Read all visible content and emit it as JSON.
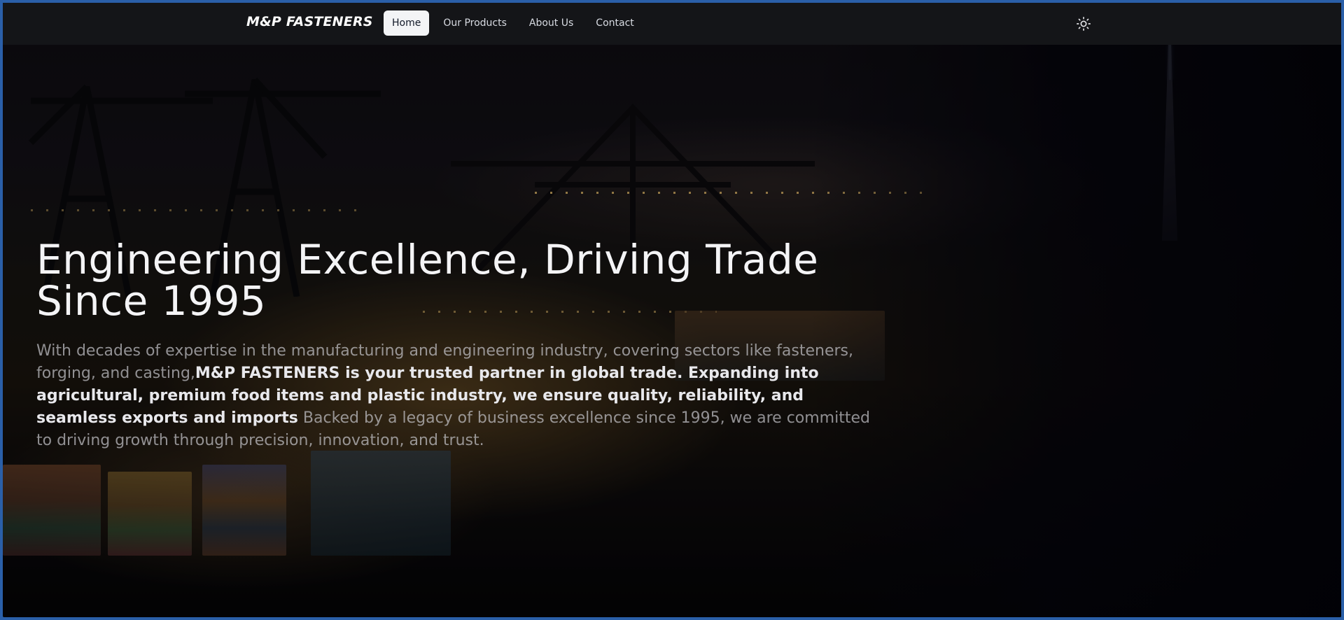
{
  "brand": {
    "name": "M&P FASTENERS"
  },
  "nav": {
    "items": [
      {
        "label": "Home",
        "active": true
      },
      {
        "label": "Our Products",
        "active": false
      },
      {
        "label": "About Us",
        "active": false
      },
      {
        "label": "Contact",
        "active": false
      }
    ],
    "theme_toggle_icon": "sun-icon"
  },
  "hero": {
    "title_line1": "Engineering Excellence, Driving Trade",
    "title_line2": "Since 1995",
    "desc_intro": "With decades of expertise in the manufacturing and engineering industry, covering sectors like fasteners, forging, and casting,",
    "desc_bold": "M&P FASTENERS is your trusted partner in global trade. Expanding into agricultural, premium food items and plastic industry, we ensure quality, reliability, and seamless exports and imports",
    "desc_outro": " Backed by a legacy of business excellence since 1995, we are committed to driving growth through precision, innovation, and trust."
  },
  "colors": {
    "frame_glow": "#2a5fa8",
    "navbar_bg": "#141518",
    "active_tab_bg": "#f3f4f6",
    "title_text": "#f4f4f6"
  }
}
